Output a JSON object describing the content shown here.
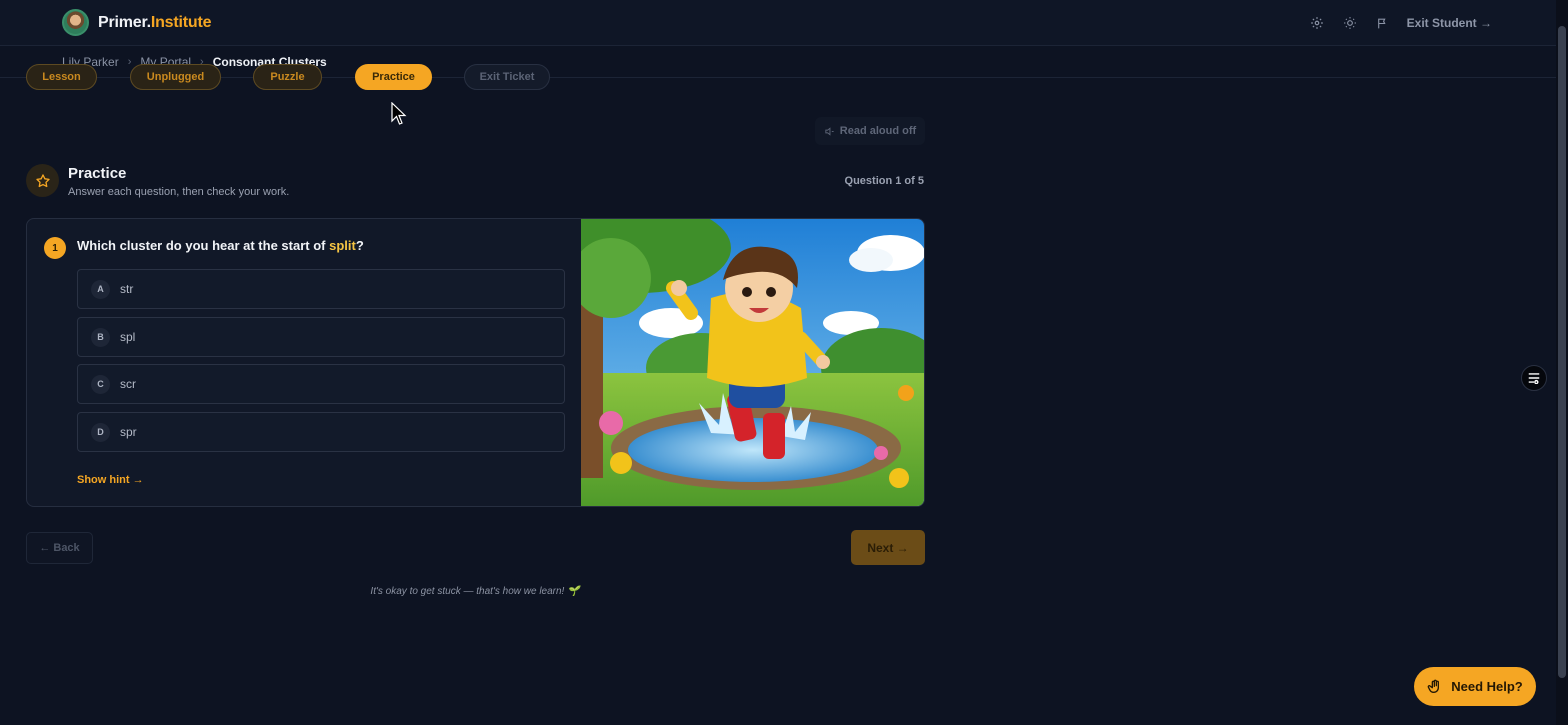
{
  "brand": {
    "name_part1": "Primer.",
    "name_part2": "Institute"
  },
  "topbar": {
    "exit_label": "Exit Student →"
  },
  "breadcrumb": {
    "items": [
      "Lily Parker",
      "My Portal"
    ],
    "current": "Consonant Clusters"
  },
  "steps": [
    {
      "label": "Lesson",
      "state": "done"
    },
    {
      "label": "Unplugged",
      "state": "done"
    },
    {
      "label": "Puzzle",
      "state": "done"
    },
    {
      "label": "Practice",
      "state": "active"
    },
    {
      "label": "Exit Ticket",
      "state": "locked"
    }
  ],
  "read_aloud": "Read aloud off",
  "practice": {
    "title": "Practice",
    "subtitle": "Answer each question, then check your work.",
    "question_count": "Question 1 of 5"
  },
  "question": {
    "number": "1",
    "text_before": "Which cluster do you hear at the start of ",
    "highlight": "split",
    "text_after": "?",
    "options": [
      {
        "letter": "A",
        "text": "str"
      },
      {
        "letter": "B",
        "text": "spl"
      },
      {
        "letter": "C",
        "text": "scr"
      },
      {
        "letter": "D",
        "text": "spr"
      }
    ],
    "hint_label": "Show hint →"
  },
  "nav": {
    "back_label": "← Back",
    "next_label": "Next →"
  },
  "encouragement": "It's okay to get stuck — that's how we learn! 🌱",
  "help_label": "Need Help?",
  "colors": {
    "accent": "#f5a623",
    "background": "#0d1322",
    "card": "#111828"
  }
}
